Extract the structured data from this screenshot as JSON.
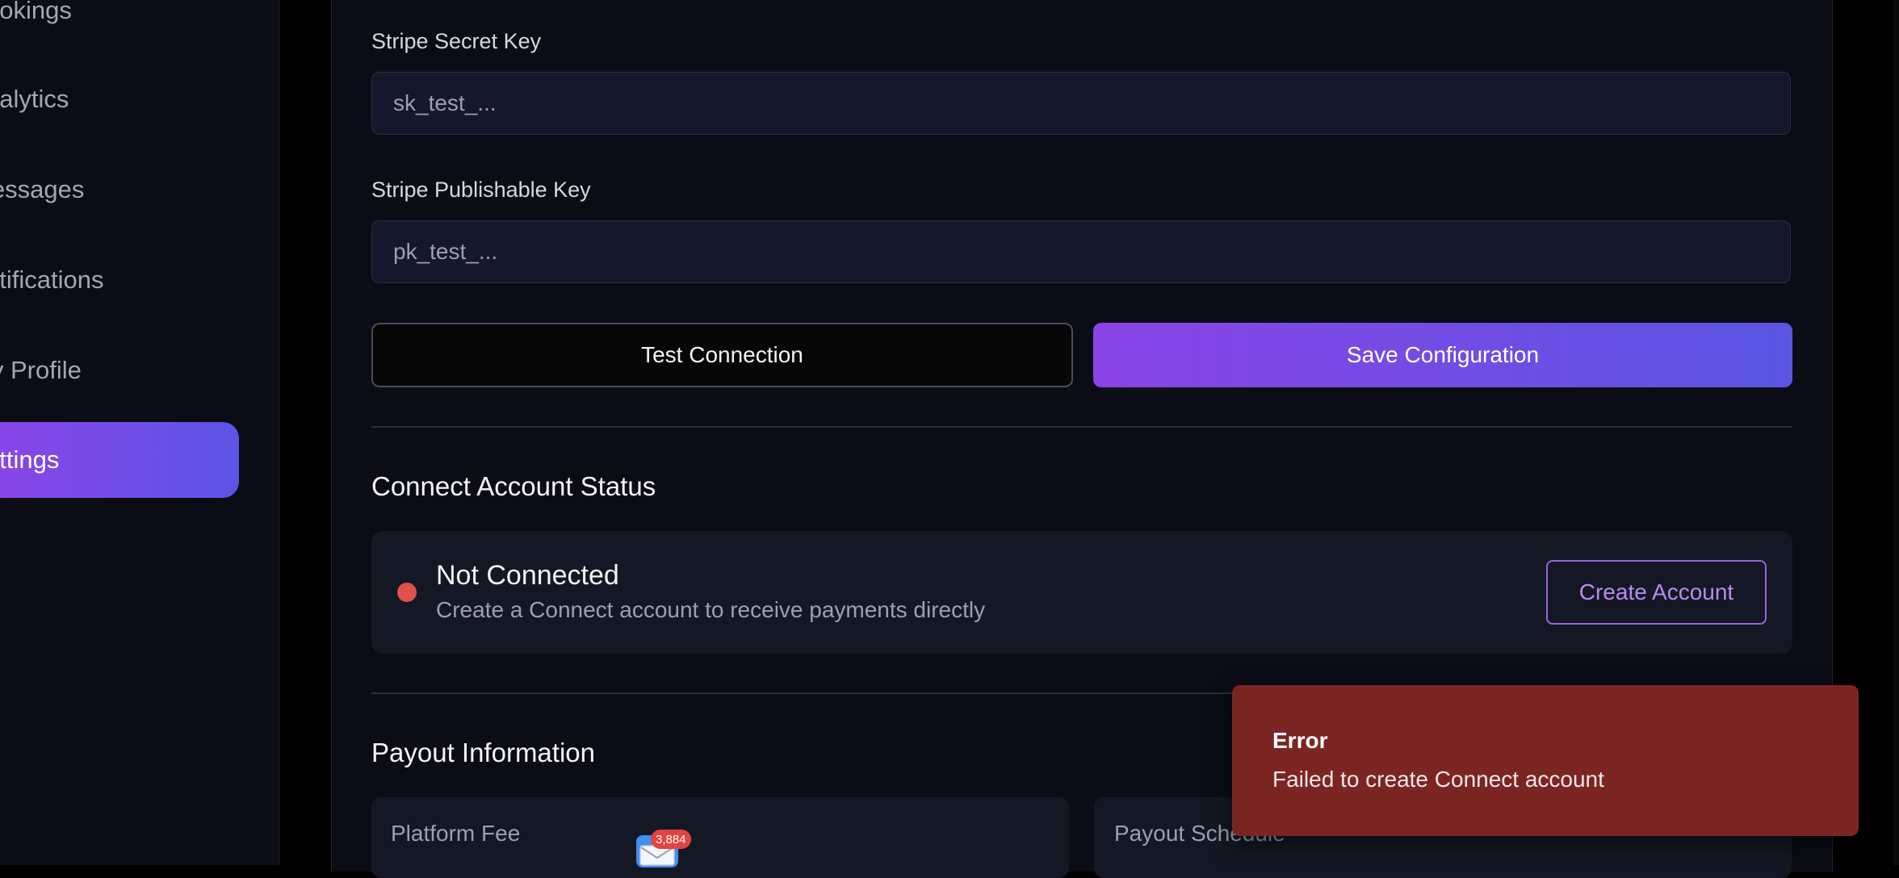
{
  "sidebar": {
    "items": [
      {
        "label": "ookings"
      },
      {
        "label": "nalytics"
      },
      {
        "label": "lessages"
      },
      {
        "label": "otifications"
      },
      {
        "label": "ly Profile"
      },
      {
        "label": "ettings",
        "active": true
      }
    ]
  },
  "stripe": {
    "secret_label": "Stripe Secret Key",
    "secret_placeholder": "sk_test_...",
    "publishable_label": "Stripe Publishable Key",
    "publishable_placeholder": "pk_test_...",
    "test_button": "Test Connection",
    "save_button": "Save Configuration"
  },
  "connect": {
    "section_title": "Connect Account Status",
    "status_title": "Not Connected",
    "status_desc": "Create a Connect account to receive payments directly",
    "status_color": "#e0504c",
    "create_button": "Create Account"
  },
  "payout": {
    "section_title": "Payout Information",
    "platform_fee_label": "Platform Fee",
    "payout_schedule_label": "Payout Schedule"
  },
  "toast": {
    "title": "Error",
    "message": "Failed to create Connect account"
  },
  "dock": {
    "mail_icon": "mail-icon",
    "mail_badge": "3,884"
  },
  "colors": {
    "accent_gradient_start": "#8a44e6",
    "accent_gradient_end": "#5a55e2",
    "error_toast": "#7b2523"
  }
}
